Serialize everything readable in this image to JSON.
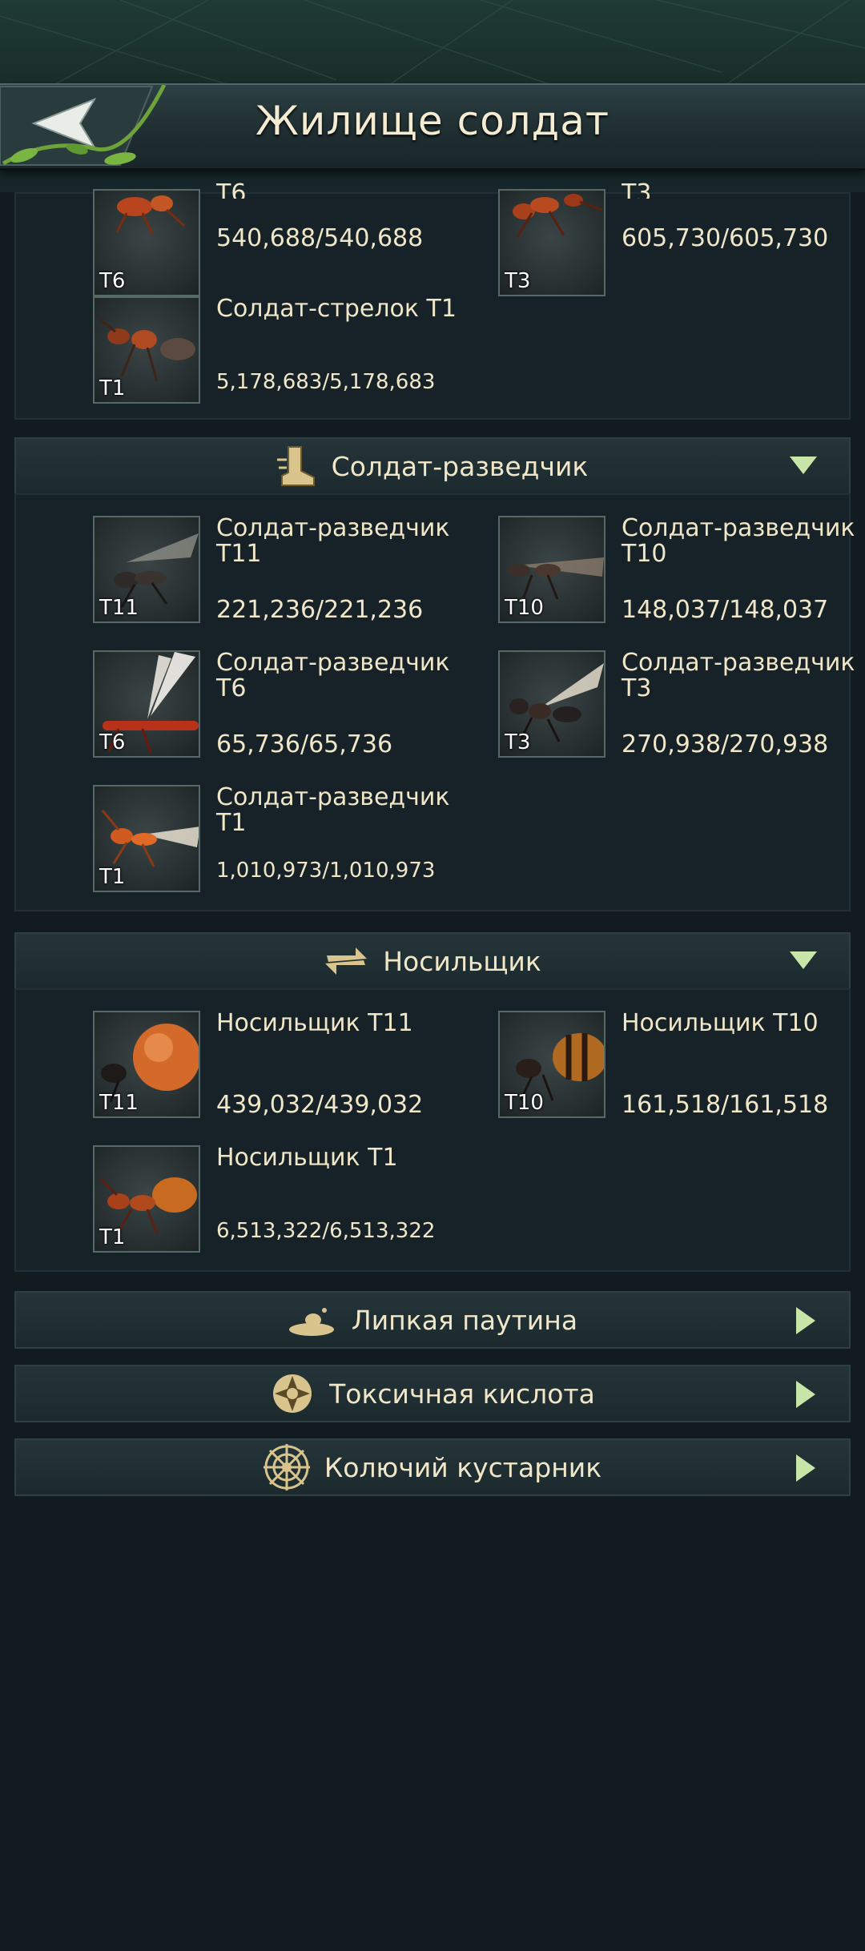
{
  "header": {
    "title": "Жилище солдат"
  },
  "sections": {
    "top_partial": {
      "units": [
        {
          "tier": "T6",
          "name": "T6",
          "count": "540,688/540,688"
        },
        {
          "tier": "T3",
          "name": "T3",
          "count": "605,730/605,730"
        },
        {
          "tier": "T1",
          "name": "Солдат-стрелок T1",
          "count": "5,178,683/5,178,683"
        }
      ]
    },
    "scout": {
      "label": "Солдат-разведчик",
      "icon": "boot-icon",
      "units": [
        {
          "tier": "T11",
          "name": "Солдат-разведчик T11",
          "count": "221,236/221,236"
        },
        {
          "tier": "T10",
          "name": "Солдат-разведчик T10",
          "count": "148,037/148,037"
        },
        {
          "tier": "T6",
          "name": "Солдат-разведчик T6",
          "count": "65,736/65,736"
        },
        {
          "tier": "T3",
          "name": "Солдат-разведчик T3",
          "count": "270,938/270,938"
        },
        {
          "tier": "T1",
          "name": "Солдат-разведчик T1",
          "count": "1,010,973/1,010,973"
        }
      ]
    },
    "carrier": {
      "label": "Носильщик",
      "icon": "arrows-icon",
      "units": [
        {
          "tier": "T11",
          "name": "Носильщик T11",
          "count": "439,032/439,032"
        },
        {
          "tier": "T10",
          "name": "Носильщик T10",
          "count": "161,518/161,518"
        },
        {
          "tier": "T1",
          "name": "Носильщик T1",
          "count": "6,513,322/6,513,322"
        }
      ]
    }
  },
  "traps": [
    {
      "label": "Липкая паутина",
      "icon": "sticky-web-icon"
    },
    {
      "label": "Токсичная кислота",
      "icon": "acid-icon"
    },
    {
      "label": "Колючий кустарник",
      "icon": "thorn-bush-icon"
    }
  ],
  "colors": {
    "accent": "#c8e6a8",
    "text": "#f0e6c8",
    "panel": "#162228"
  }
}
